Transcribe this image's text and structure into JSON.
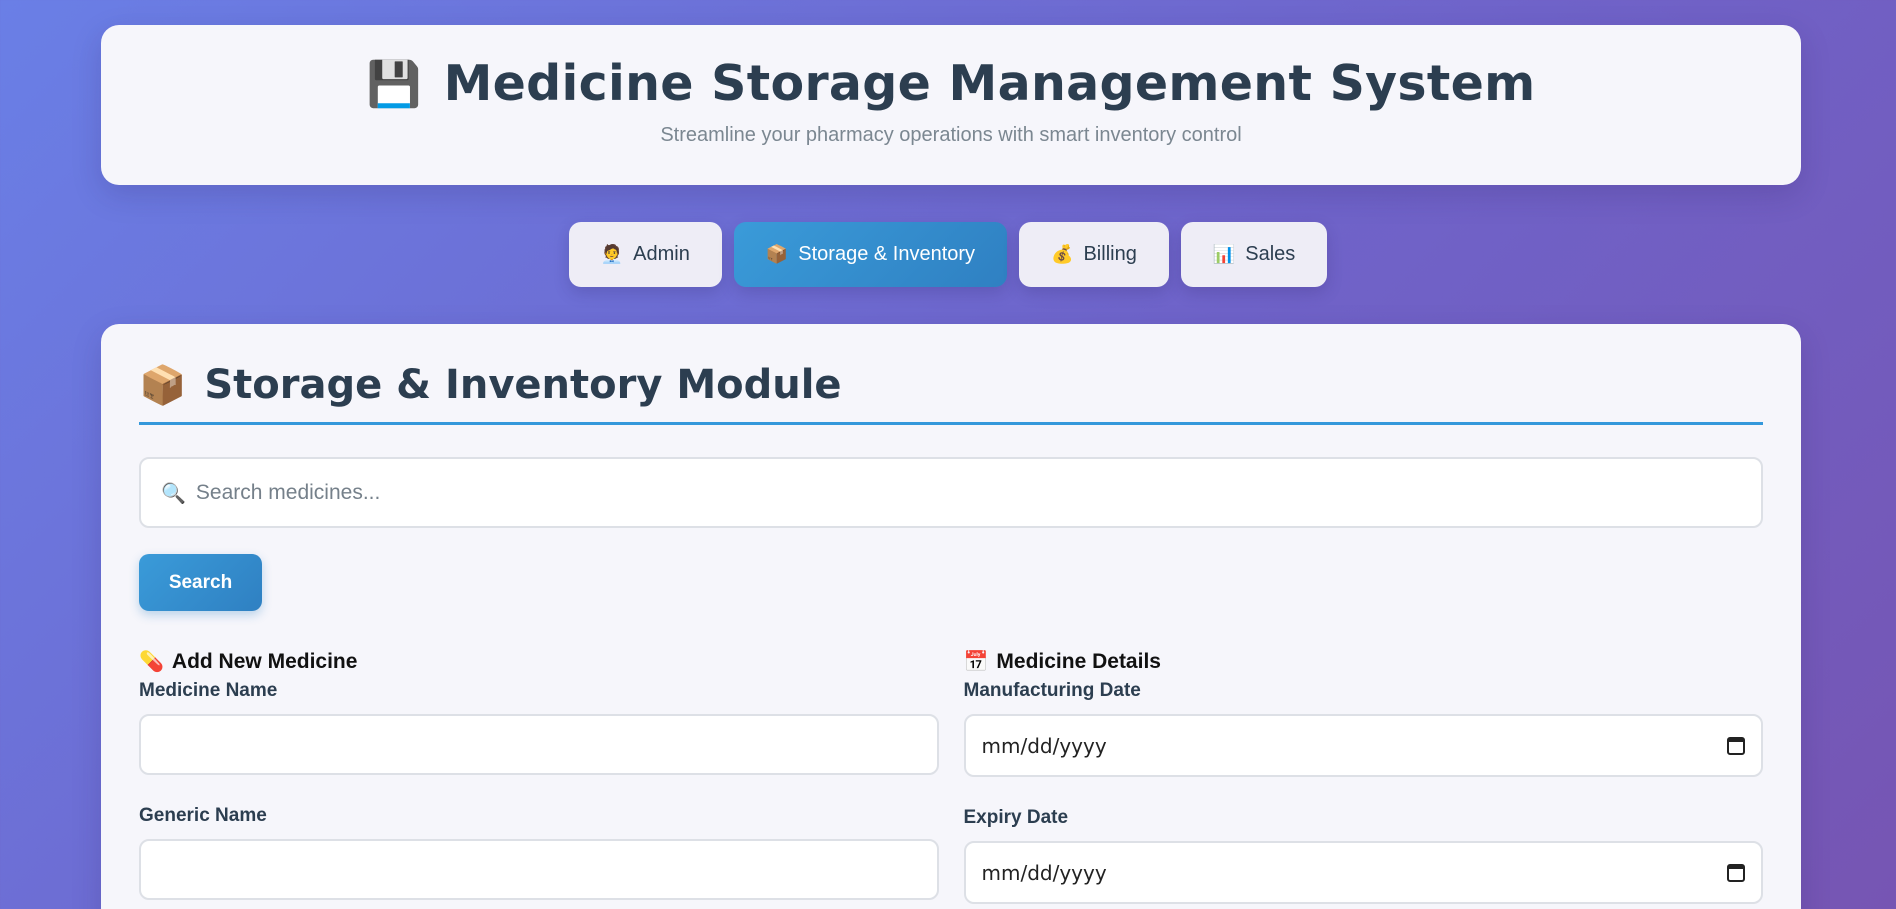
{
  "header": {
    "icon": "hospital-storage-icon",
    "emoji": "💾",
    "title": "Medicine Storage Management System",
    "subtitle": "Streamline your pharmacy operations with smart inventory control"
  },
  "tabs": [
    {
      "emoji": "🧑‍💼",
      "label": "Admin",
      "active": false
    },
    {
      "emoji": "📦",
      "label": "Storage & Inventory",
      "active": true
    },
    {
      "emoji": "💰",
      "label": "Billing",
      "active": false
    },
    {
      "emoji": "📊",
      "label": "Sales",
      "active": false
    }
  ],
  "module": {
    "emoji": "📦",
    "title": "Storage & Inventory Module"
  },
  "search": {
    "emoji": "🔍",
    "placeholder": "Search medicines...",
    "value": "",
    "button_label": "Search"
  },
  "add_medicine": {
    "emoji": "💊",
    "title": "Add New Medicine",
    "fields": [
      {
        "label": "Medicine Name",
        "value": ""
      },
      {
        "label": "Generic Name",
        "value": ""
      }
    ]
  },
  "medicine_details": {
    "emoji": "📅",
    "title": "Medicine Details",
    "fields": [
      {
        "label": "Manufacturing Date",
        "placeholder": "mm/dd/yyyy"
      },
      {
        "label": "Expiry Date",
        "placeholder": "mm/dd/yyyy"
      }
    ]
  },
  "colors": {
    "accent": "#3498db",
    "text": "#2c3e50"
  }
}
